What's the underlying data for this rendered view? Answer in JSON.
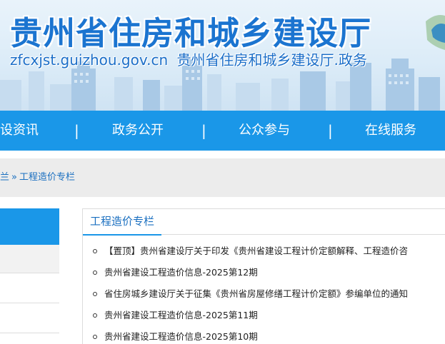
{
  "header": {
    "title": "贵州省住房和城乡建设厅",
    "domain": "zfcxjst.guizhou.gov.cn",
    "subtitle": "贵州省住房和城乡建设厅.政务",
    "accent": "#1b74d0"
  },
  "nav": {
    "color": "#1a97e8",
    "items": [
      "设资讯",
      "政务公开",
      "公众参与",
      "在线服务"
    ],
    "separator": "|"
  },
  "breadcrumb": {
    "parent": "兰",
    "separator": "»",
    "current": "工程造价专栏"
  },
  "panel": {
    "title": "工程造价专栏",
    "items": [
      "【置顶】贵州省建设厅关于印发《贵州省建设工程计价定额解释、工程造价咨",
      "贵州省建设工程造价信息-2025第12期",
      "省住房城乡建设厅关于征集《贵州省房屋修缮工程计价定额》参编单位的通知",
      "贵州省建设工程造价信息-2025第11期",
      "贵州省建设工程造价信息-2025第10期"
    ]
  }
}
